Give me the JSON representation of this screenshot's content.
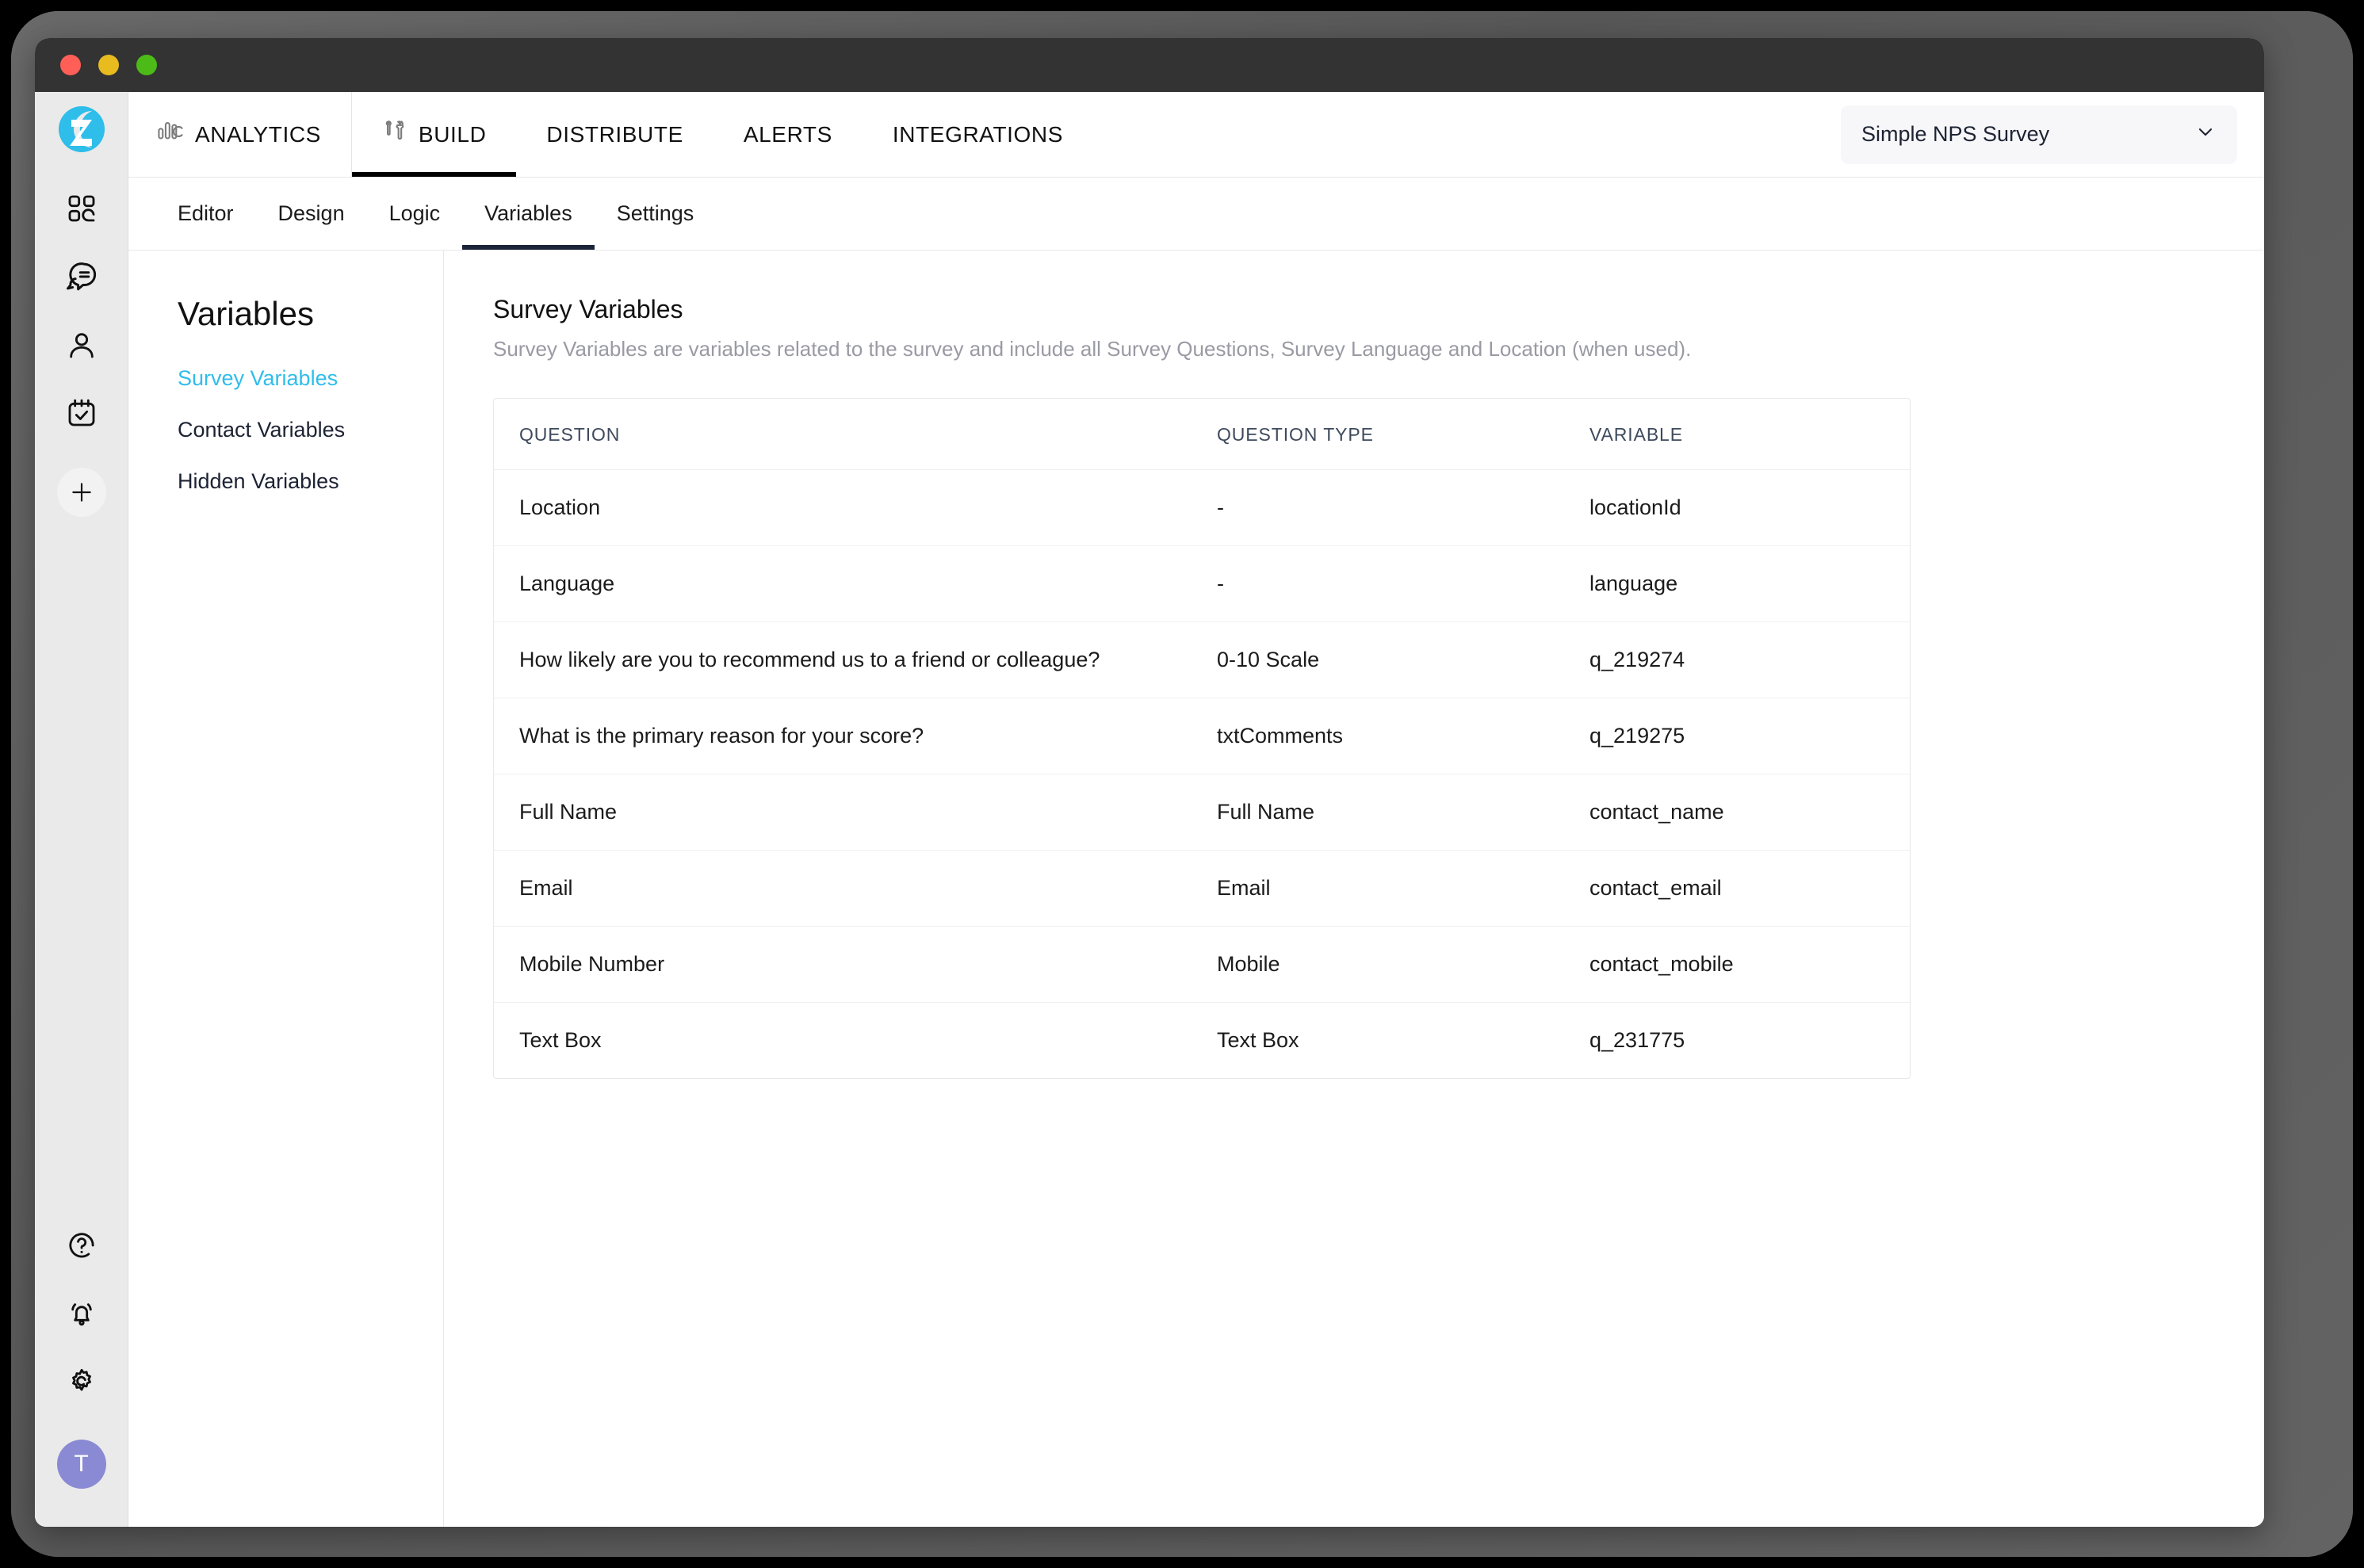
{
  "window": {
    "traffic_lights": [
      "close",
      "minimize",
      "maximize"
    ]
  },
  "rail": {
    "logo_name": "zonka-logo",
    "items": [
      {
        "icon": "grid-dashboard-icon",
        "name": "dashboard"
      },
      {
        "icon": "chat-bubbles-icon",
        "name": "feedback"
      },
      {
        "icon": "user-icon",
        "name": "contacts"
      },
      {
        "icon": "calendar-check-icon",
        "name": "tasks"
      }
    ],
    "add_label": "+",
    "bottom_items": [
      {
        "icon": "help-circle-icon",
        "name": "help"
      },
      {
        "icon": "bell-icon",
        "name": "notifications"
      },
      {
        "icon": "gear-icon",
        "name": "settings"
      }
    ],
    "avatar_initial": "T"
  },
  "topnav": {
    "items": [
      {
        "label": "ANALYTICS",
        "icon": "bar-chart-icon",
        "active": false
      },
      {
        "label": "BUILD",
        "icon": "tools-icon",
        "active": true
      },
      {
        "label": "DISTRIBUTE",
        "icon": "",
        "active": false
      },
      {
        "label": "ALERTS",
        "icon": "",
        "active": false
      },
      {
        "label": "INTEGRATIONS",
        "icon": "",
        "active": false
      }
    ],
    "survey_select": {
      "value": "Simple NPS Survey",
      "chevron": "chevron-down-icon"
    }
  },
  "subnav": {
    "items": [
      {
        "label": "Editor",
        "active": false
      },
      {
        "label": "Design",
        "active": false
      },
      {
        "label": "Logic",
        "active": false
      },
      {
        "label": "Variables",
        "active": true
      },
      {
        "label": "Settings",
        "active": false
      }
    ]
  },
  "sidepanel": {
    "title": "Variables",
    "links": [
      {
        "label": "Survey Variables",
        "active": true
      },
      {
        "label": "Contact Variables",
        "active": false
      },
      {
        "label": "Hidden Variables",
        "active": false
      }
    ]
  },
  "panel": {
    "title": "Survey Variables",
    "subtitle": "Survey Variables are variables related to the survey and include all Survey Questions, Survey Language and Location (when used).",
    "table": {
      "headers": [
        "QUESTION",
        "QUESTION TYPE",
        "VARIABLE"
      ],
      "rows": [
        {
          "question": "Location",
          "type": "-",
          "variable": "locationId"
        },
        {
          "question": "Language",
          "type": "-",
          "variable": "language"
        },
        {
          "question": "How likely are you to recommend us to a friend or colleague?",
          "type": "0-10 Scale",
          "variable": "q_219274"
        },
        {
          "question": "What is the primary reason for your score?",
          "type": "txtComments",
          "variable": "q_219275"
        },
        {
          "question": "Full Name",
          "type": "Full Name",
          "variable": "contact_name"
        },
        {
          "question": "Email",
          "type": "Email",
          "variable": "contact_email"
        },
        {
          "question": "Mobile Number",
          "type": "Mobile",
          "variable": "contact_mobile"
        },
        {
          "question": "Text Box",
          "type": "Text Box",
          "variable": "q_231775"
        }
      ]
    }
  },
  "colors": {
    "accent": "#30bdea",
    "active_underline": "#1c2439",
    "header_text": "#3e4a5c",
    "avatar_bg": "#8a8ad4",
    "rail_bg": "#eaeaea"
  }
}
